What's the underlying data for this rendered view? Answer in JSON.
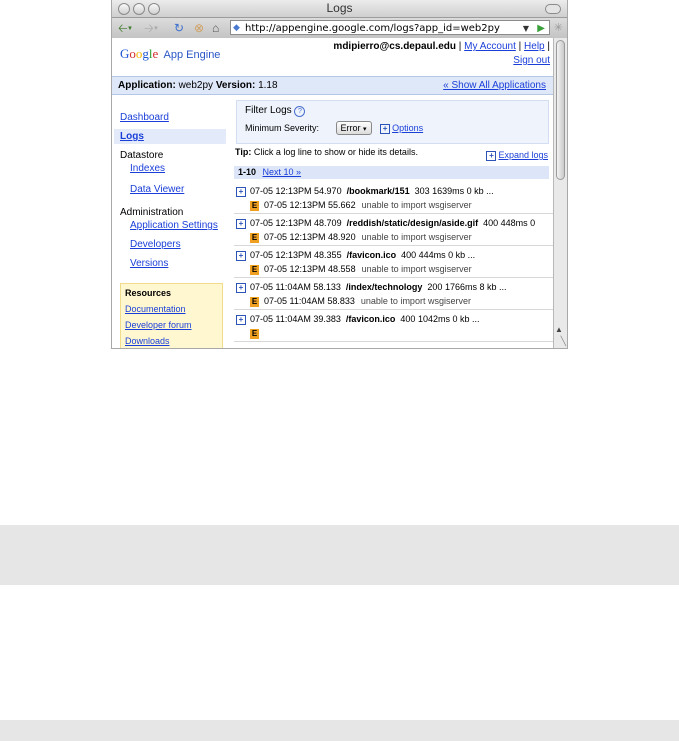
{
  "window": {
    "title": "Logs"
  },
  "toolbar": {
    "url": "http://appengine.google.com/logs?app_id=web2py"
  },
  "header": {
    "logo_google": [
      "G",
      "o",
      "o",
      "g",
      "l",
      "e"
    ],
    "logo_suffix": "App Engine",
    "user_email": "mdipierro@cs.depaul.edu",
    "my_account": "My Account",
    "help": "Help",
    "sign_out": "Sign out",
    "sep": "|"
  },
  "appbar": {
    "application_label": "Application:",
    "application_value": "web2py",
    "version_label": "Version:",
    "version_value": "1.18",
    "show_all": "« Show All Applications"
  },
  "sidebar": {
    "dashboard": "Dashboard",
    "logs": "Logs",
    "datastore": "Datastore",
    "indexes": "Indexes",
    "data_viewer": "Data Viewer",
    "administration": "Administration",
    "application_settings": "Application Settings",
    "developers": "Developers",
    "versions": "Versions"
  },
  "resources": {
    "title": "Resources",
    "documentation": "Documentation",
    "developer_forum": "Developer forum",
    "downloads": "Downloads"
  },
  "filter": {
    "title": "Filter Logs",
    "help": "?",
    "min_severity_label": "Minimum Severity:",
    "severity_value": "Error",
    "options": "Options"
  },
  "tip": {
    "label": "Tip:",
    "text": "Click a log line to show or hide its details.",
    "expand": "Expand logs"
  },
  "pager": {
    "range": "1-10",
    "next": "Next 10 »"
  },
  "logs": [
    {
      "ts": "07-05 12:13PM 54.970",
      "path": "/bookmark/151",
      "info": "303 1639ms 0 kb ...",
      "sub_ts": "07-05 12:13PM 55.662",
      "sub_msg": "unable to import wsgiserver"
    },
    {
      "ts": "07-05 12:13PM 48.709",
      "path": "/reddish/static/design/aside.gif",
      "info": "400 448ms 0",
      "sub_ts": "07-05 12:13PM 48.920",
      "sub_msg": "unable to import wsgiserver"
    },
    {
      "ts": "07-05 12:13PM 48.355",
      "path": "/favicon.ico",
      "info": "400 444ms 0 kb ...",
      "sub_ts": "07-05 12:13PM 48.558",
      "sub_msg": "unable to import wsgiserver"
    },
    {
      "ts": "07-05 11:04AM 58.133",
      "path": "/index/technology",
      "info": "200 1766ms 8 kb ...",
      "sub_ts": "07-05 11:04AM 58.833",
      "sub_msg": "unable to import wsgiserver"
    },
    {
      "ts": "07-05 11:04AM 39.383",
      "path": "/favicon.ico",
      "info": "400 1042ms 0 kb ...",
      "sub_ts": "",
      "sub_msg": ""
    }
  ],
  "badge": "E",
  "plus": "+",
  "icons": {
    "back": "back-arrow-icon",
    "forward": "forward-arrow-icon",
    "reload": "reload-icon",
    "stop": "stop-icon",
    "home": "home-icon"
  }
}
